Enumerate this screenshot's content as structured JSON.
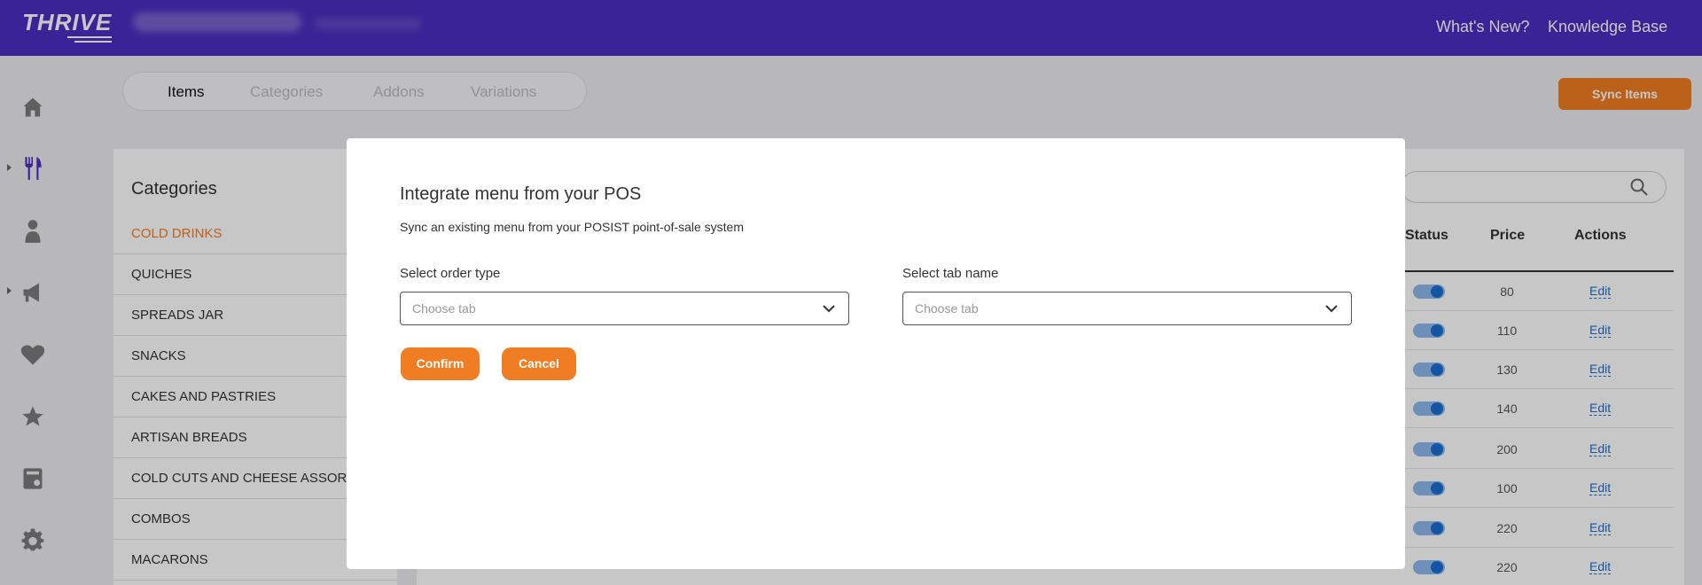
{
  "header": {
    "logo": "THRIVE",
    "links": [
      "What's New?",
      "Knowledge Base"
    ]
  },
  "sidebar": {
    "icons": [
      "home-icon",
      "fork-knife-icon",
      "user-icon",
      "megaphone-icon",
      "heart-icon",
      "star-icon",
      "report-icon",
      "gear-icon"
    ]
  },
  "tabs": [
    "Items",
    "Categories",
    "Addons",
    "Variations"
  ],
  "sync_button": "Sync Items",
  "categories": {
    "title": "Categories",
    "items": [
      "COLD DRINKS",
      "QUICHES",
      "SPREADS JAR",
      "SNACKS",
      "CAKES AND PASTRIES",
      "ARTISAN BREADS",
      "COLD CUTS AND CHEESE ASSORTM",
      "COMBOS",
      "MACARONS"
    ]
  },
  "table": {
    "headers": [
      "Status",
      "Price",
      "Actions"
    ],
    "rows": [
      {
        "price": "80",
        "action": "Edit"
      },
      {
        "price": "110",
        "action": "Edit"
      },
      {
        "price": "130",
        "action": "Edit"
      },
      {
        "price": "140",
        "action": "Edit"
      },
      {
        "price": "200",
        "action": "Edit"
      },
      {
        "price": "100",
        "action": "Edit"
      },
      {
        "price": "220",
        "action": "Edit"
      },
      {
        "price": "220",
        "action": "Edit"
      }
    ]
  },
  "modal": {
    "title": "Integrate menu from your POS",
    "subtitle": "Sync an existing menu from your POSIST point-of-sale system",
    "order_type_label": "Select order type",
    "order_type_placeholder": "Choose tab",
    "tab_name_label": "Select tab name",
    "tab_name_placeholder": "Choose tab",
    "confirm": "Confirm",
    "cancel": "Cancel"
  },
  "colors": {
    "header": "#4b2ec0",
    "accent": "#f07d22",
    "link": "#1a6fd1"
  }
}
